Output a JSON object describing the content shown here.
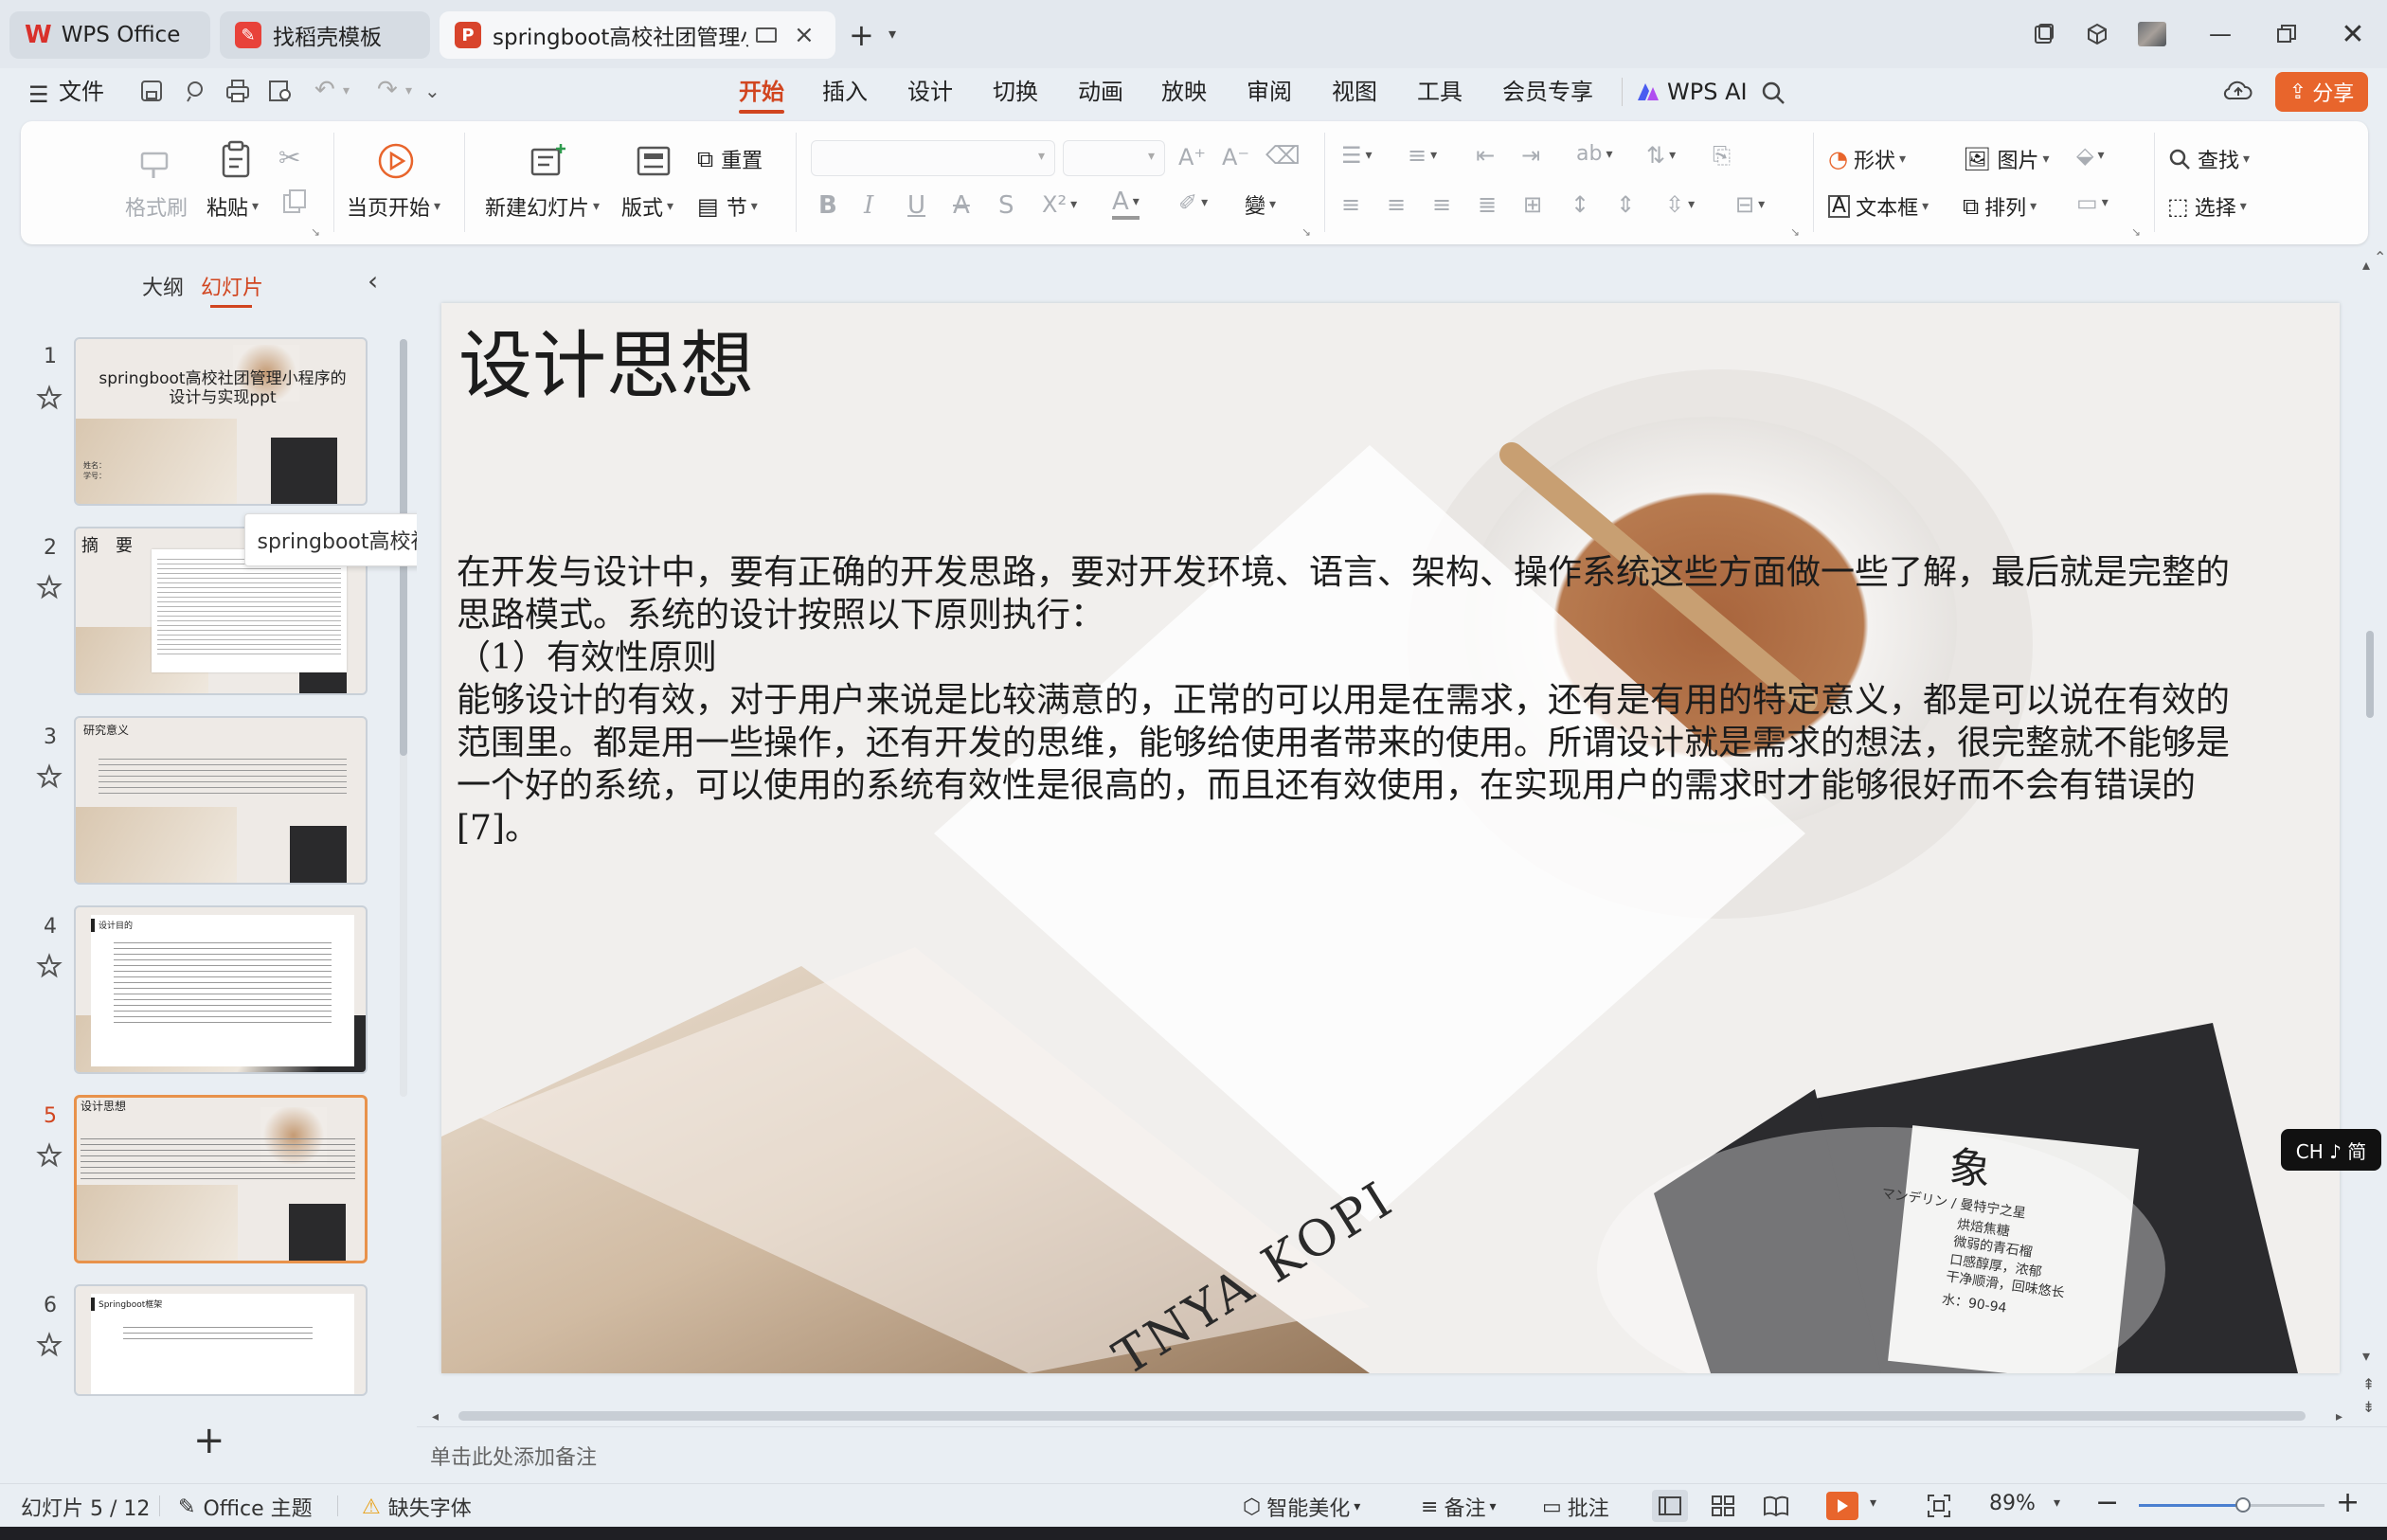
{
  "titlebar": {
    "tabs": [
      {
        "label": "WPS Office",
        "icon": "wps-logo-icon"
      },
      {
        "label": "找稻壳模板",
        "icon": "docer-icon"
      },
      {
        "label": "springboot高校社团管理小",
        "icon": "ppt-file-icon"
      }
    ],
    "new_tab_label": "+"
  },
  "menubar": {
    "file_label": "文件",
    "tabs": [
      "开始",
      "插入",
      "设计",
      "切换",
      "动画",
      "放映",
      "审阅",
      "视图",
      "工具",
      "会员专享"
    ],
    "active_tab": "开始",
    "wps_ai_label": "WPS AI",
    "share_label": "分享",
    "share_color": "#e8652c"
  },
  "ribbon": {
    "format_painter": "格式刷",
    "paste": "粘贴",
    "play_from_current": "当页开始",
    "new_slide": "新建幻灯片",
    "layout": "版式",
    "reset": "重置",
    "section": "节",
    "shape": "形状",
    "picture": "图片",
    "textbox": "文本框",
    "arrange": "排列",
    "find": "查找",
    "select": "选择"
  },
  "leftpanel": {
    "outline_tab": "大纲",
    "slides_tab": "幻灯片",
    "tooltip": "springboot高校社...",
    "slides": [
      {
        "num": "1",
        "title": "springboot高校社团管理小程序的设计与实现ppt",
        "sub": "姓名：\n学号："
      },
      {
        "num": "2",
        "title": "摘　要"
      },
      {
        "num": "3",
        "title": "研究意义"
      },
      {
        "num": "4",
        "title": "设计目的"
      },
      {
        "num": "5",
        "title": "设计思想"
      },
      {
        "num": "6",
        "title": "Springboot框架"
      }
    ],
    "selected": "5",
    "add_slide": "+"
  },
  "slide": {
    "title": "设计思想",
    "paragraphs": [
      "在开发与设计中，要有正确的开发思路，要对开发环境、语言、架构、操作系统这些方面做一些了解，最后就是完整的思路模式。系统的设计按照以下原则执行：",
      "（1）有效性原则",
      "能够设计的有效，对于用户来说是比较满意的，正常的可以用是在需求，还有是有用的特定意义，都是可以说在有效的范围里。都是用一些操作，还有开发的思维，能够给使用者带来的使用。所谓设计就是需求的想法，很完整就不能够是一个好的系统，可以使用的系统有效性是很高的，而且还有效使用，在实现用户的需求时才能够很好而不会有错误的[7]。"
    ],
    "image_text": {
      "brand": "TNYA KOPI",
      "pack_char": "象",
      "pack_line1": "マンデリン / 曼特宁之星",
      "pack_line2": "烘焙焦糖",
      "pack_line3": "微弱的青石榴",
      "pack_line4": "口感醇厚，浓郁",
      "pack_line5": "干净顺滑，回味悠长",
      "pack_line6": "水：90-94"
    }
  },
  "notes_placeholder": "单击此处添加备注",
  "ime_badge": "CH ♪ 简",
  "statusbar": {
    "slide_counter": "幻灯片 5 / 12",
    "theme": "Office 主题",
    "missing_font": "缺失字体",
    "beautify": "智能美化",
    "notes": "备注",
    "comments": "批注",
    "zoom": "89%",
    "zoom_fraction": 0.56
  }
}
